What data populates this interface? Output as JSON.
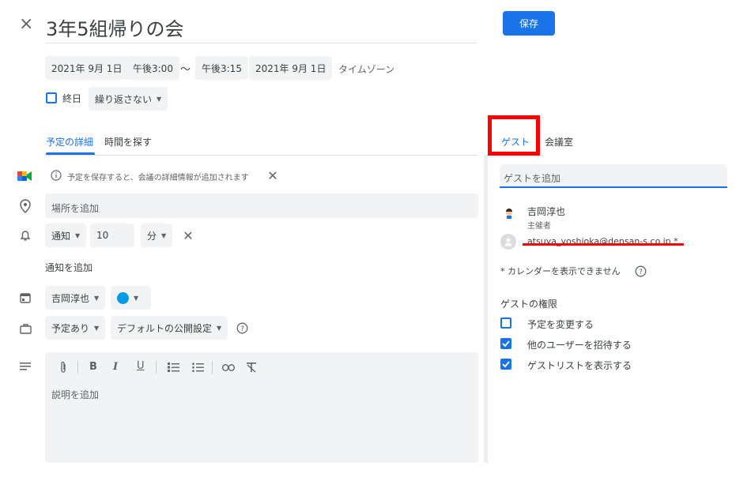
{
  "header": {
    "close_label": "×",
    "title": "3年5組帰りの会",
    "save_label": "保存"
  },
  "datetime": {
    "start_date": "2021年 9月 1日",
    "start_time": "午後3:00",
    "separator": "〜",
    "end_time": "午後3:15",
    "end_date": "2021年 9月 1日",
    "timezone": "タイムゾーン"
  },
  "allday": {
    "label": "終日",
    "repeat": "繰り返さない"
  },
  "left_tabs": {
    "details": "予定の詳細",
    "find_time": "時間を探す"
  },
  "meet": {
    "info": "予定を保存すると、会議の詳細情報が追加されます"
  },
  "location": {
    "placeholder": "場所を追加"
  },
  "notification": {
    "type": "通知",
    "value": "10",
    "unit": "分",
    "add_label": "通知を追加"
  },
  "calendar": {
    "owner": "吉岡淳也",
    "color": "#039be5"
  },
  "visibility": {
    "busy": "予定あり",
    "default": "デフォルトの公開設定"
  },
  "description": {
    "toolbar": {
      "bold": "B",
      "italic": "I",
      "underline": "U"
    },
    "placeholder": "説明を追加"
  },
  "right_tabs": {
    "guests": "ゲスト",
    "rooms": "会議室"
  },
  "guests": {
    "add_placeholder": "ゲストを追加",
    "organizer_name": "吉岡淳也",
    "organizer_role": "主催者",
    "guest_email": "atsuya_yoshioka@densan-s.co.jp *",
    "calendar_notice": "* カレンダーを表示できません",
    "permissions_heading": "ゲストの権限",
    "permissions": [
      {
        "label": "予定を変更する",
        "checked": false
      },
      {
        "label": "他のユーザーを招待する",
        "checked": true
      },
      {
        "label": "ゲストリストを表示する",
        "checked": true
      }
    ]
  },
  "colors": {
    "accent": "#1a73e8",
    "highlight_red": "#ff0000",
    "chip_bg": "#f1f3f4"
  }
}
